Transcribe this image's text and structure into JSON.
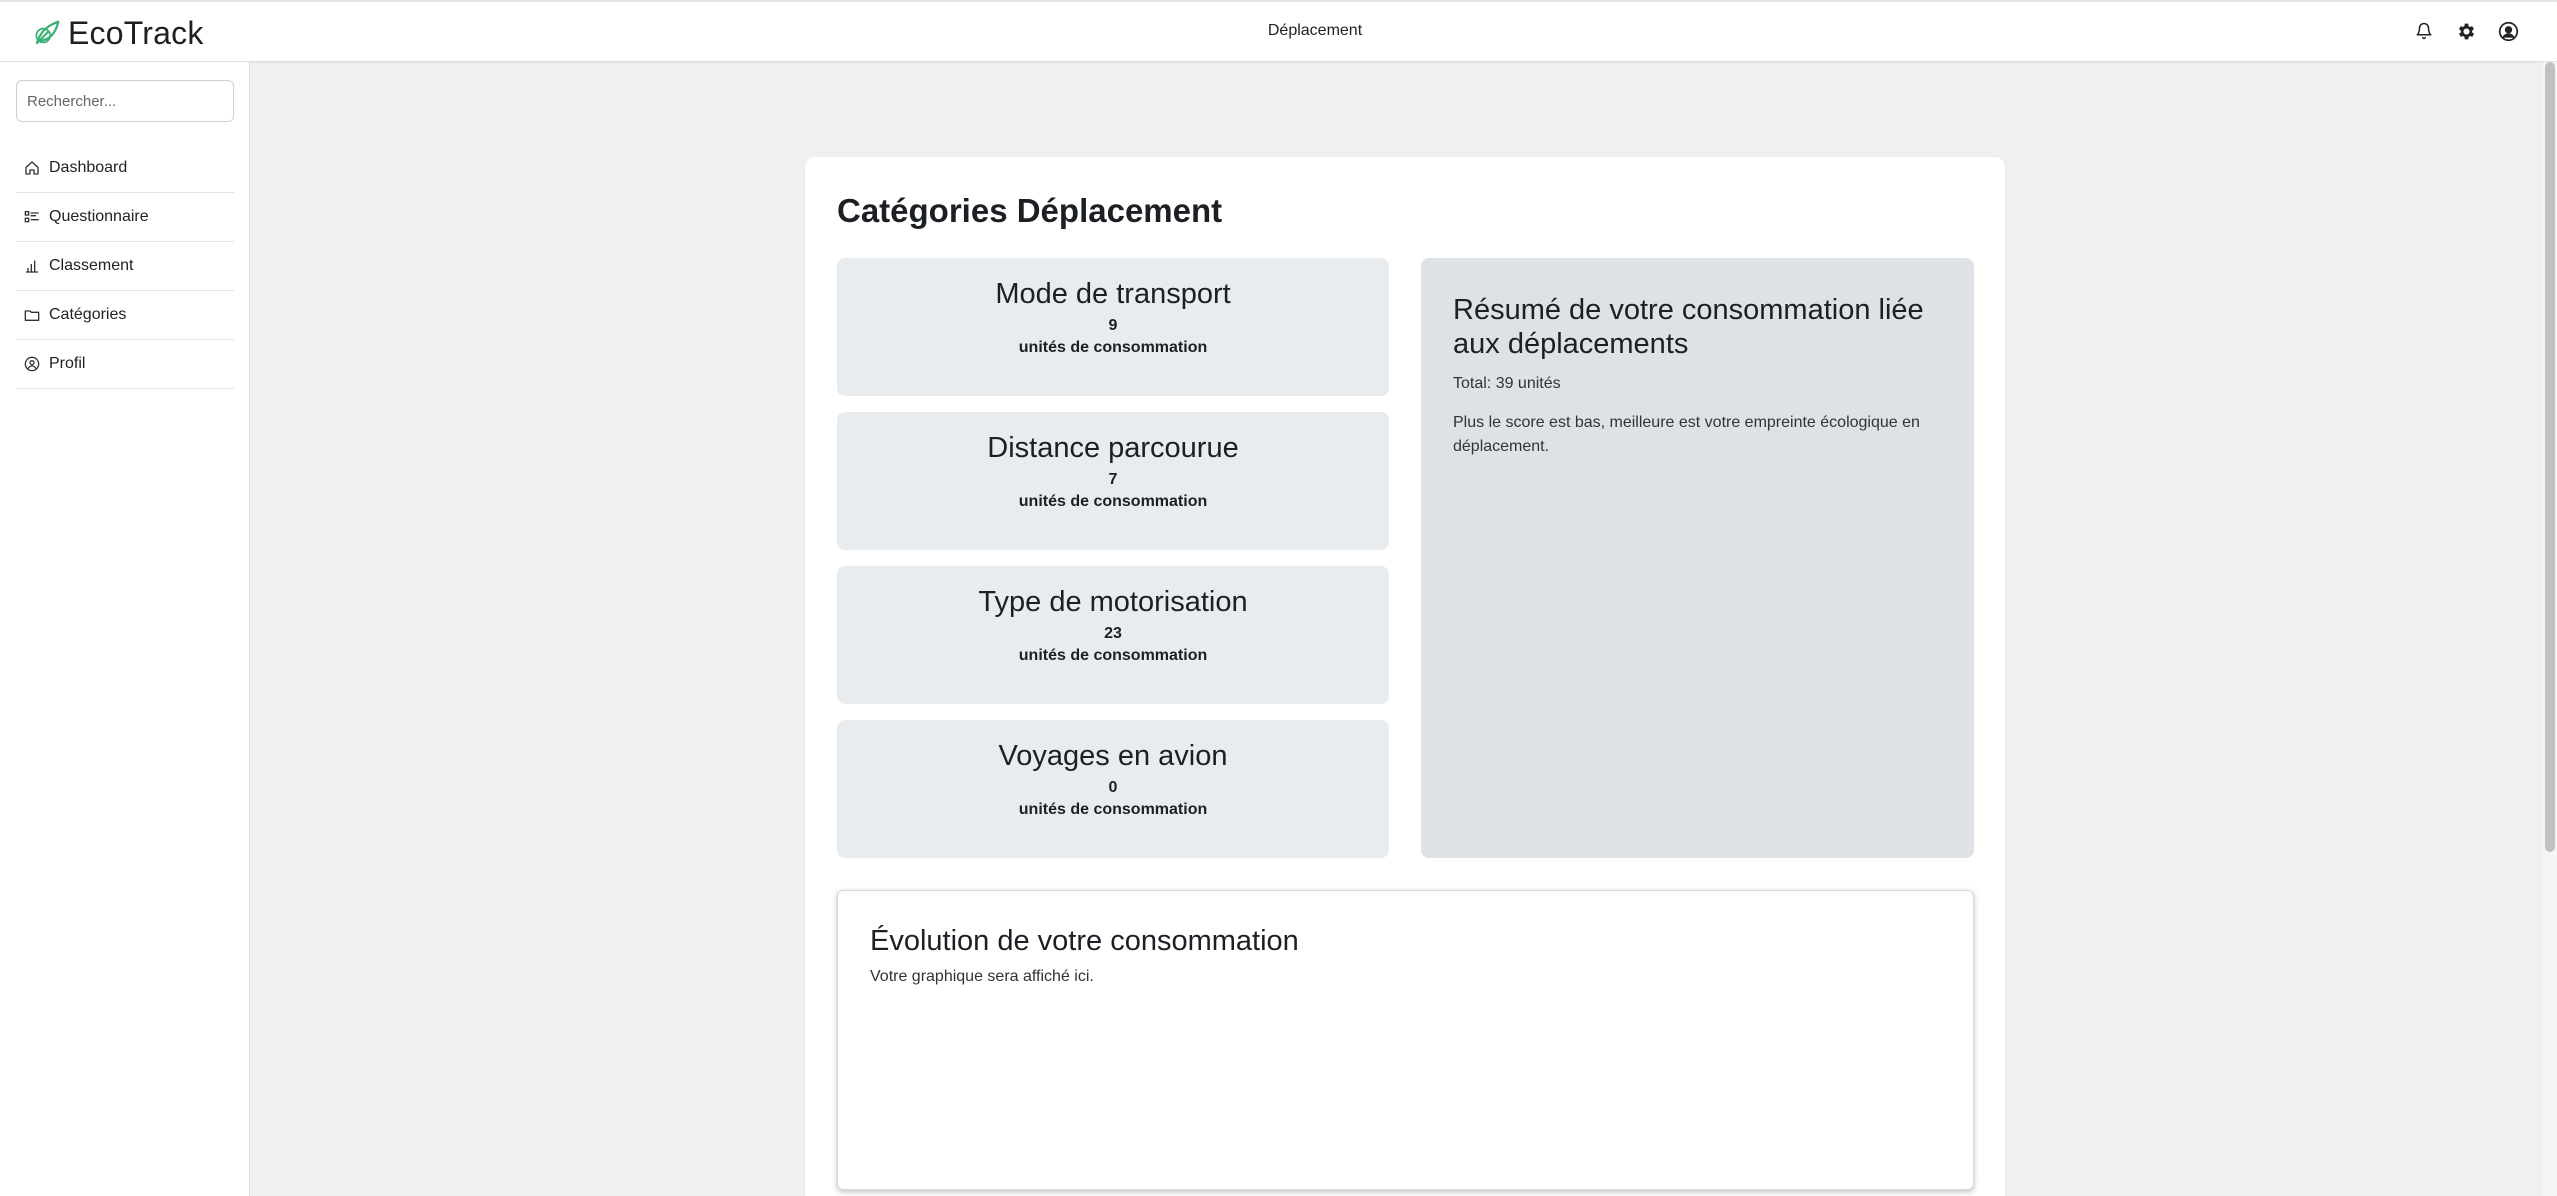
{
  "header": {
    "brand_name": "EcoTrack",
    "page_label": "Déplacement",
    "icons": [
      "bell-icon",
      "gear-icon",
      "user-circle-icon"
    ]
  },
  "sidebar": {
    "search_placeholder": "Rechercher...",
    "items": [
      {
        "label": "Dashboard",
        "icon": "home-icon"
      },
      {
        "label": "Questionnaire",
        "icon": "list-icon"
      },
      {
        "label": "Classement",
        "icon": "bar-chart-icon"
      },
      {
        "label": "Catégories",
        "icon": "folder-icon"
      },
      {
        "label": "Profil",
        "icon": "user-circle-icon"
      }
    ]
  },
  "main": {
    "title": "Catégories Déplacement",
    "tiles": [
      {
        "title": "Mode de transport",
        "value": "9",
        "unit": "unités de consommation"
      },
      {
        "title": "Distance parcourue",
        "value": "7",
        "unit": "unités de consommation"
      },
      {
        "title": "Type de motorisation",
        "value": "23",
        "unit": "unités de consommation"
      },
      {
        "title": "Voyages en avion",
        "value": "0",
        "unit": "unités de consommation"
      }
    ],
    "summary": {
      "title": "Résumé de votre consommation liée aux déplacements",
      "total": "Total: 39 unités",
      "note": "Plus le score est bas, meilleure est votre empreinte écologique en déplacement."
    },
    "evolution": {
      "title": "Évolution de votre consommation",
      "subtitle": "Votre graphique sera affiché ici."
    }
  },
  "colors": {
    "brand_accent": "#3bb273",
    "tile_bg": "#e9ecef",
    "summary_bg": "#dee2e6",
    "page_bg": "#f0f0f0"
  }
}
